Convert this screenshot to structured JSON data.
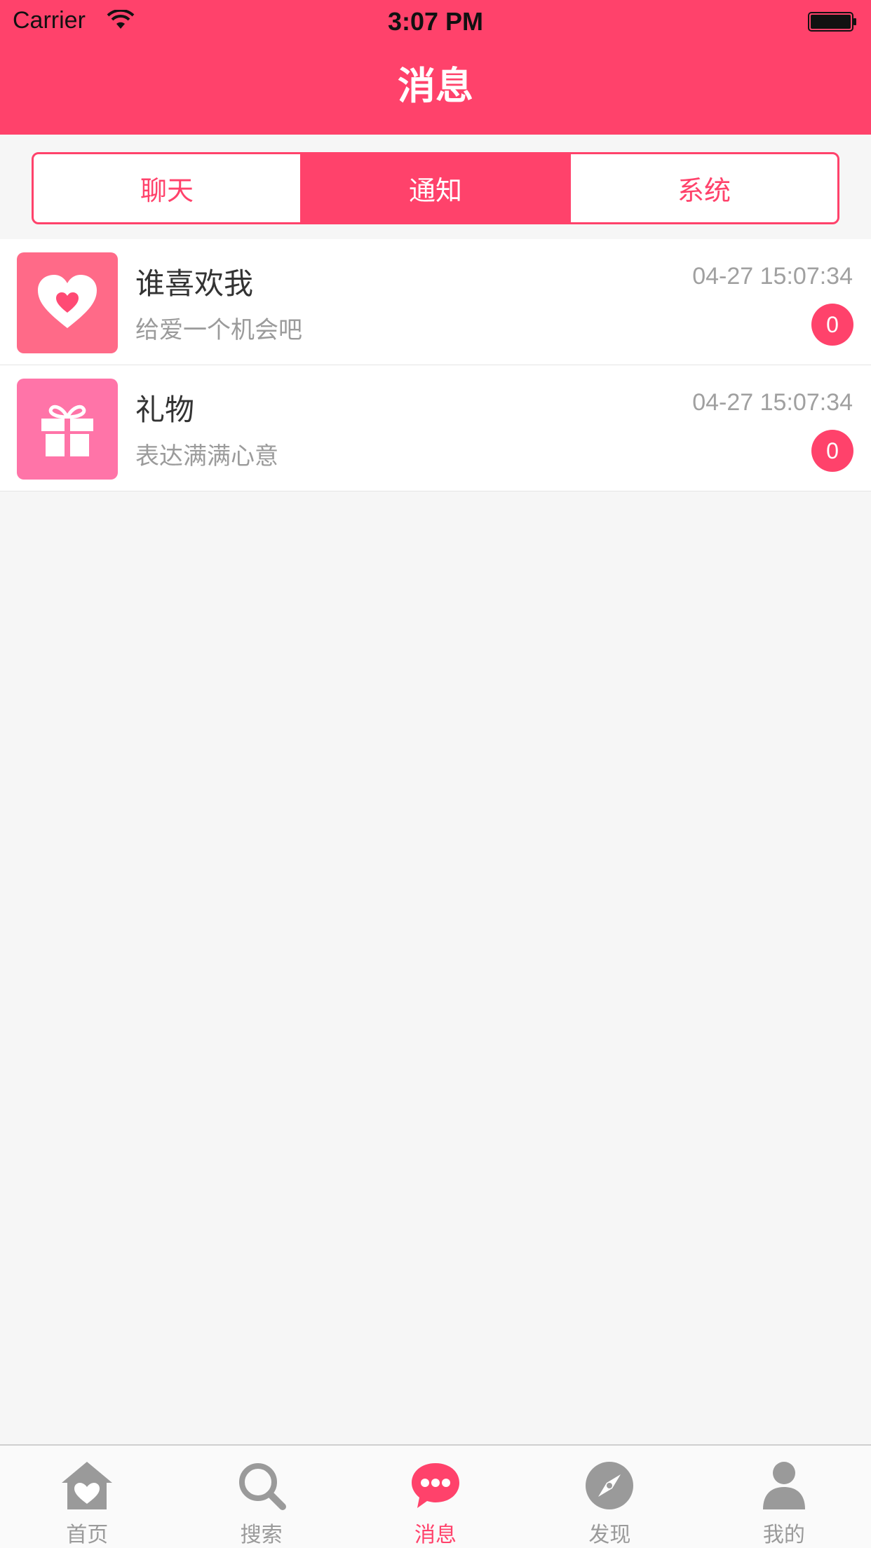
{
  "status_bar": {
    "carrier": "Carrier",
    "time": "3:07 PM"
  },
  "nav": {
    "title": "消息"
  },
  "segments": [
    {
      "label": "聊天",
      "active": false
    },
    {
      "label": "通知",
      "active": true
    },
    {
      "label": "系统",
      "active": false
    }
  ],
  "notifications": [
    {
      "icon": "heart-icon",
      "icon_bg": "#ff6a88",
      "title": "谁喜欢我",
      "subtitle": "给爱一个机会吧",
      "time": "04-27 15:07:34",
      "count": "0"
    },
    {
      "icon": "gift-icon",
      "icon_bg": "#ff74a8",
      "title": "礼物",
      "subtitle": "表达满满心意",
      "time": "04-27 15:07:34",
      "count": "0"
    }
  ],
  "tabbar": {
    "items": [
      {
        "label": "首页",
        "icon": "home-icon",
        "active": false
      },
      {
        "label": "搜索",
        "icon": "search-icon",
        "active": false
      },
      {
        "label": "消息",
        "icon": "message-icon",
        "active": true
      },
      {
        "label": "发现",
        "icon": "compass-icon",
        "active": false
      },
      {
        "label": "我的",
        "icon": "profile-icon",
        "active": false
      }
    ]
  },
  "colors": {
    "accent": "#ff426b",
    "icon_gray": "#9a9a9a",
    "background": "#f6f6f6"
  }
}
